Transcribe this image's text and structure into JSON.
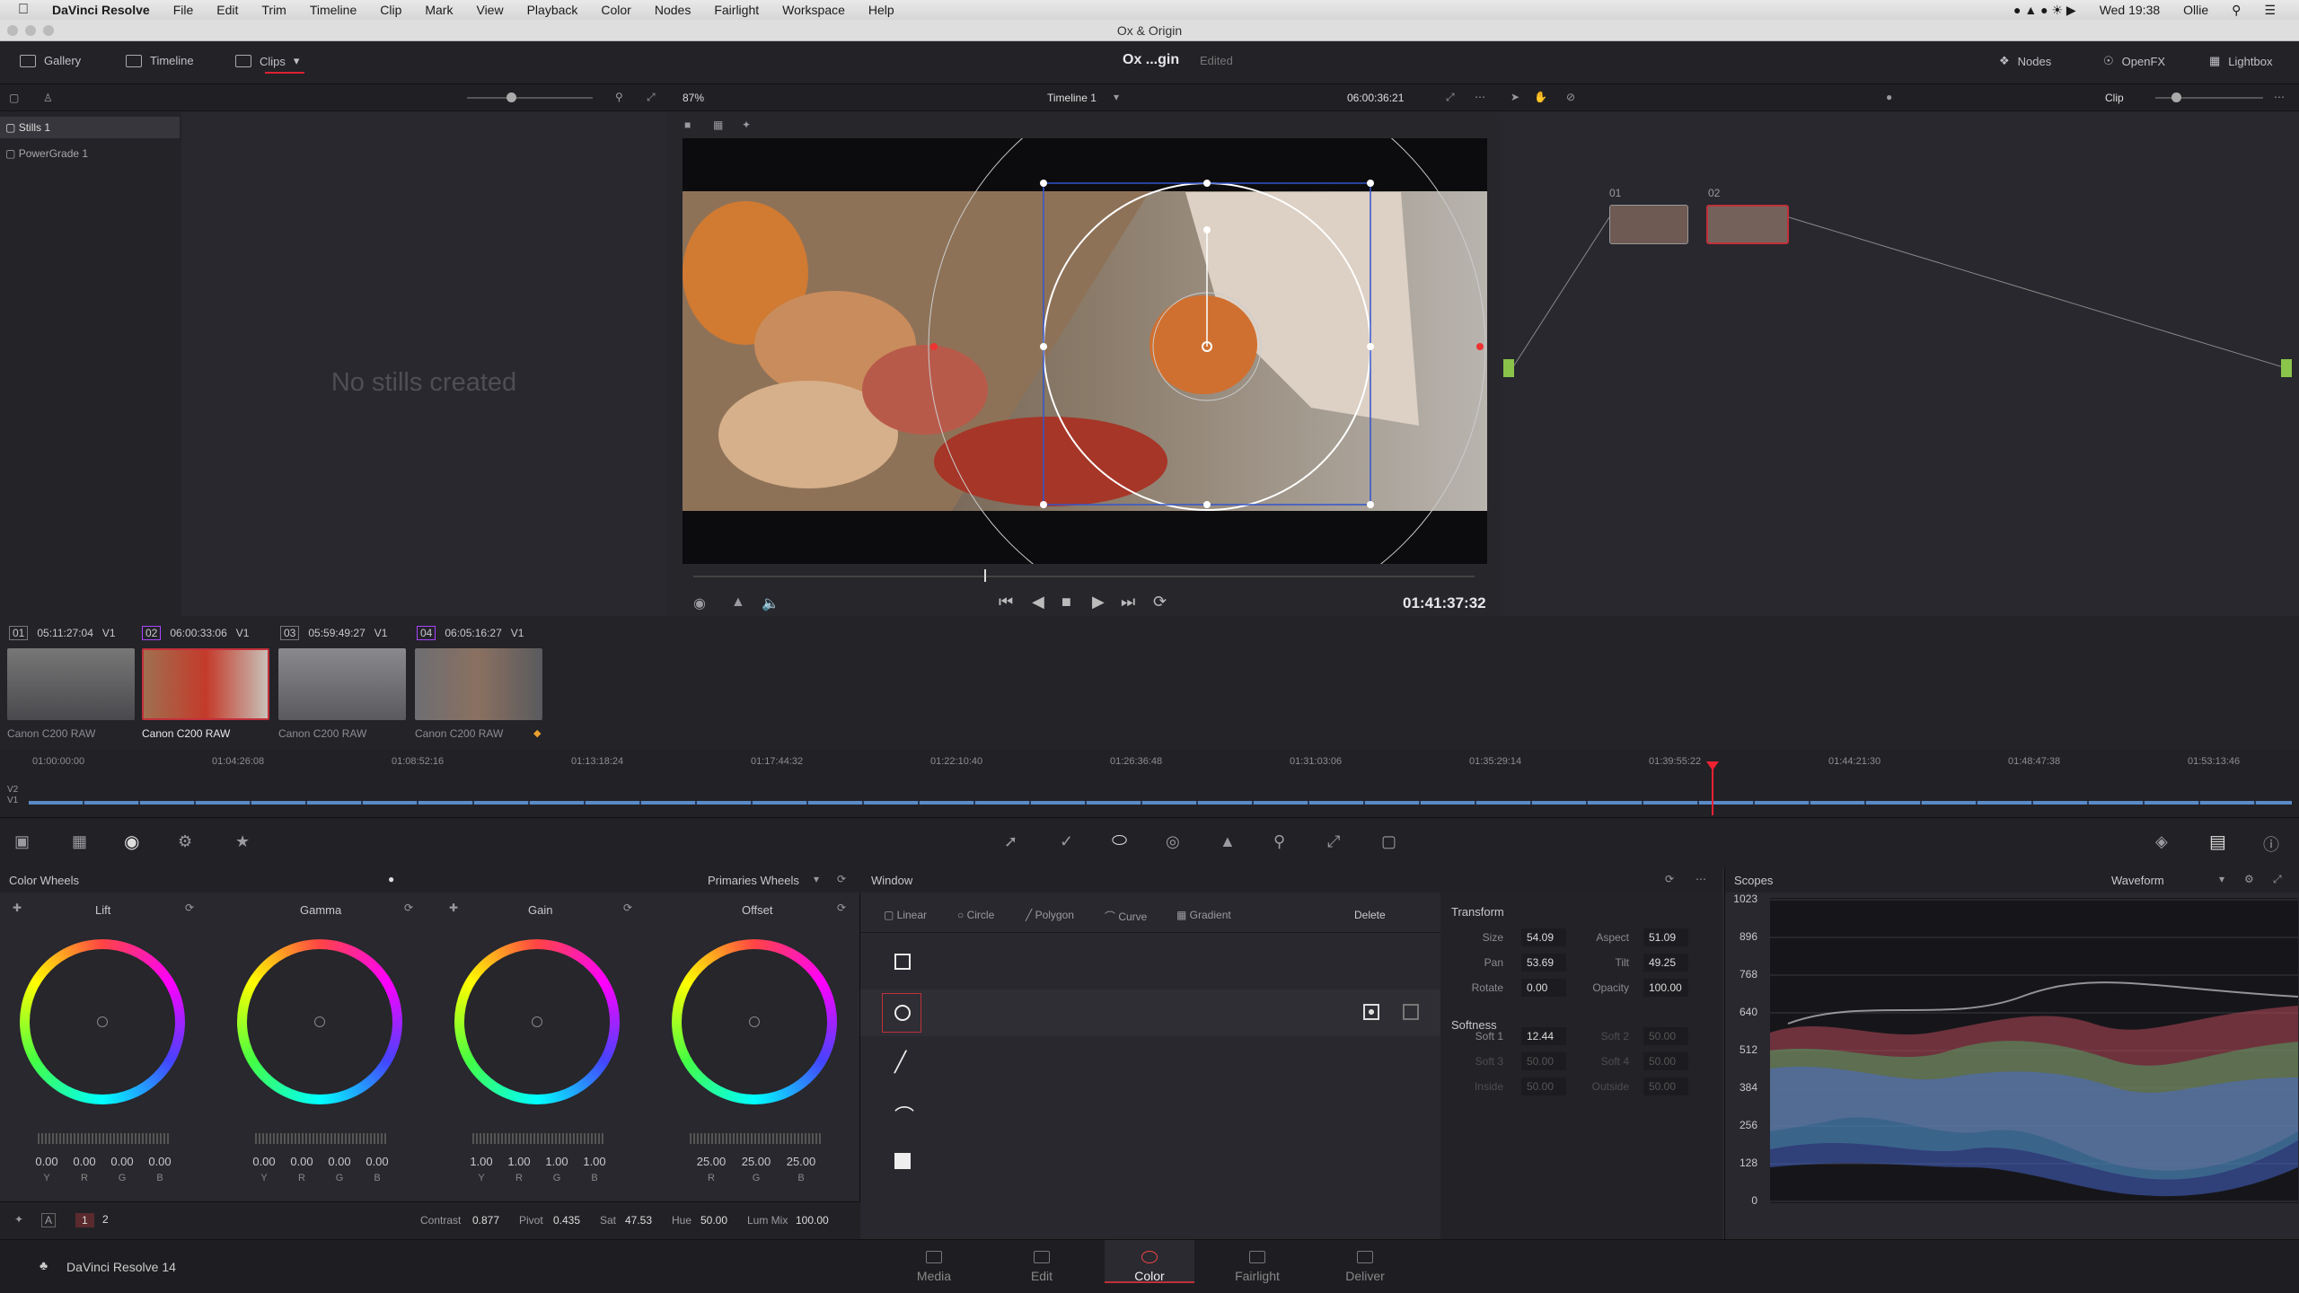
{
  "macbar": {
    "app": "DaVinci Resolve",
    "menus": [
      "File",
      "Edit",
      "Trim",
      "Timeline",
      "Clip",
      "Mark",
      "View",
      "Playback",
      "Color",
      "Nodes",
      "Fairlight",
      "Workspace",
      "Help"
    ],
    "clock": "Wed 19:38",
    "user": "Ollie"
  },
  "window_title": "Ox & Origin",
  "toolbar": {
    "gallery": "Gallery",
    "timeline": "Timeline",
    "clips": "Clips",
    "project": "Ox ...gin",
    "status": "Edited",
    "nodes": "Nodes",
    "openfx": "OpenFX",
    "lightbox": "Lightbox"
  },
  "viewer": {
    "zoom": "87%",
    "timeline_name": "Timeline 1",
    "timecode_top": "06:00:36:21",
    "timecode": "01:41:37:32",
    "mode": "Clip"
  },
  "gallery": {
    "stills": "Stills 1",
    "powergrade": "PowerGrade 1",
    "empty": "No stills created"
  },
  "clips": [
    {
      "num": "01",
      "tc": "05:11:27:04",
      "track": "V1",
      "label": "Canon C200 RAW"
    },
    {
      "num": "02",
      "tc": "06:00:33:06",
      "track": "V1",
      "label": "Canon C200 RAW"
    },
    {
      "num": "03",
      "tc": "05:59:49:27",
      "track": "V1",
      "label": "Canon C200 RAW"
    },
    {
      "num": "04",
      "tc": "06:05:16:27",
      "track": "V1",
      "label": "Canon C200 RAW"
    }
  ],
  "ruler": [
    "01:00:00:00",
    "01:04:26:08",
    "01:08:52:16",
    "01:13:18:24",
    "01:17:44:32",
    "01:22:10:40",
    "01:26:36:48",
    "01:31:03:06",
    "01:35:29:14",
    "01:39:55:22",
    "01:44:21:30",
    "01:48:47:38",
    "01:53:13:46"
  ],
  "tracks": {
    "v2": "V2",
    "v1": "V1"
  },
  "nodes": {
    "n1": "01",
    "n2": "02"
  },
  "color_wheels": {
    "title": "Color Wheels",
    "mode": "Primaries Wheels",
    "wheels": [
      {
        "name": "Lift",
        "vals": [
          "0.00",
          "0.00",
          "0.00",
          "0.00"
        ],
        "chans": [
          "Y",
          "R",
          "G",
          "B"
        ]
      },
      {
        "name": "Gamma",
        "vals": [
          "0.00",
          "0.00",
          "0.00",
          "0.00"
        ],
        "chans": [
          "Y",
          "R",
          "G",
          "B"
        ]
      },
      {
        "name": "Gain",
        "vals": [
          "1.00",
          "1.00",
          "1.00",
          "1.00"
        ],
        "chans": [
          "Y",
          "R",
          "G",
          "B"
        ]
      },
      {
        "name": "Offset",
        "vals": [
          "25.00",
          "25.00",
          "25.00"
        ],
        "chans": [
          "R",
          "G",
          "B"
        ]
      }
    ],
    "footer": {
      "p1": "1",
      "p2": "2",
      "contrast_l": "Contrast",
      "contrast": "0.877",
      "pivot_l": "Pivot",
      "pivot": "0.435",
      "sat_l": "Sat",
      "sat": "47.53",
      "hue_l": "Hue",
      "hue": "50.00",
      "lummix_l": "Lum Mix",
      "lummix": "100.00"
    }
  },
  "window_panel": {
    "title": "Window",
    "tools": [
      "Linear",
      "Circle",
      "Polygon",
      "Curve",
      "Gradient"
    ],
    "delete": "Delete",
    "transform": {
      "title": "Transform",
      "size_l": "Size",
      "size": "54.09",
      "aspect_l": "Aspect",
      "aspect": "51.09",
      "pan_l": "Pan",
      "pan": "53.69",
      "tilt_l": "Tilt",
      "tilt": "49.25",
      "rotate_l": "Rotate",
      "rotate": "0.00",
      "opacity_l": "Opacity",
      "opacity": "100.00"
    },
    "softness": {
      "title": "Softness",
      "s1_l": "Soft 1",
      "s1": "12.44",
      "s2_l": "Soft 2",
      "s2": "50.00",
      "s3_l": "Soft 3",
      "s3": "50.00",
      "s4_l": "Soft 4",
      "s4": "50.00",
      "in_l": "Inside",
      "in": "50.00",
      "out_l": "Outside",
      "out": "50.00"
    }
  },
  "scopes": {
    "title": "Scopes",
    "mode": "Waveform",
    "yticks": [
      "1023",
      "896",
      "768",
      "640",
      "512",
      "384",
      "256",
      "128",
      "0"
    ]
  },
  "pages": [
    "Media",
    "Edit",
    "Color",
    "Fairlight",
    "Deliver"
  ],
  "active_page": "Color",
  "brand": "DaVinci Resolve 14"
}
